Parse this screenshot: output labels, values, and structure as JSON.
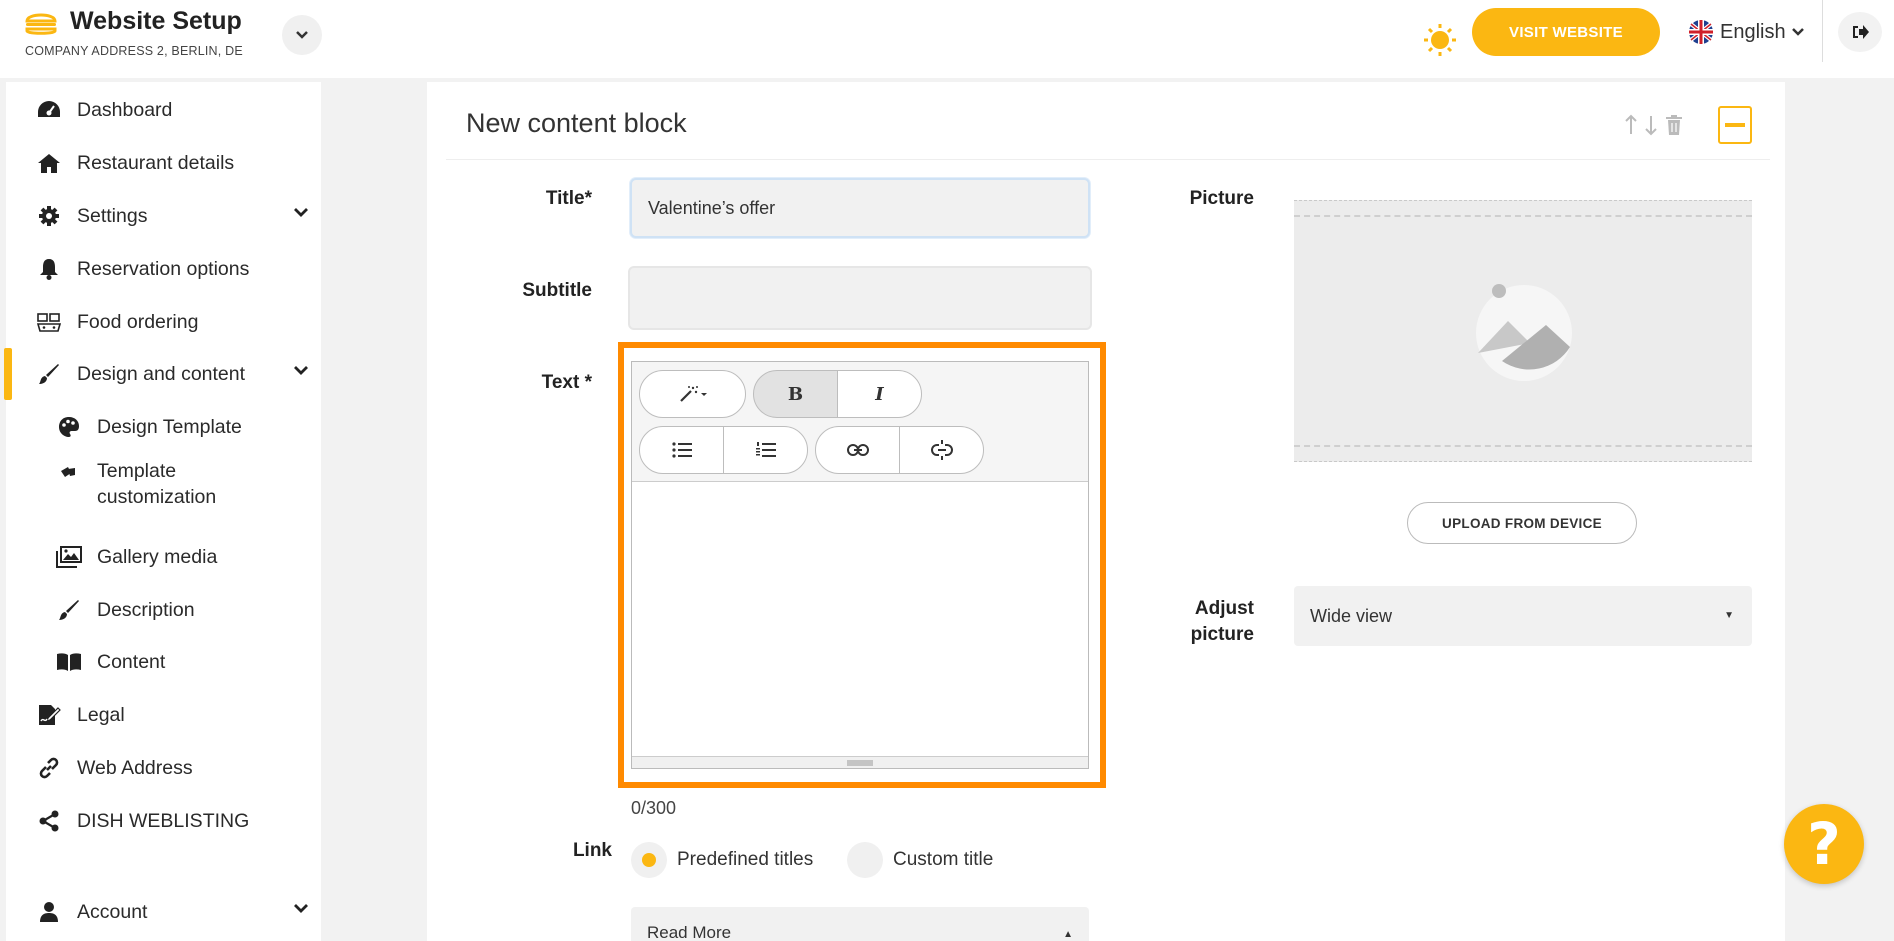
{
  "header": {
    "title": "Website Setup",
    "subtitle": "COMPANY ADDRESS 2, BERLIN, DE",
    "visit_label": "VISIT WEBSITE",
    "language": "English",
    "accent_color": "#fbb712"
  },
  "sidebar": {
    "items": [
      {
        "label": "Dashboard",
        "icon": "dashboard-icon"
      },
      {
        "label": "Restaurant details",
        "icon": "home-icon"
      },
      {
        "label": "Settings",
        "icon": "gear-icon"
      },
      {
        "label": "Reservation options",
        "icon": "bell-icon"
      },
      {
        "label": "Food ordering",
        "icon": "food-ordering-icon"
      },
      {
        "label": "Design and content",
        "icon": "paintbrush-icon"
      },
      {
        "label": "Design Template",
        "icon": "palette-icon"
      },
      {
        "label": "Template customization",
        "icon": "swatches-icon"
      },
      {
        "label": "Gallery media",
        "icon": "image-icon"
      },
      {
        "label": "Description",
        "icon": "paintbrush-icon"
      },
      {
        "label": "Content",
        "icon": "book-icon"
      },
      {
        "label": "Legal",
        "icon": "signature-icon"
      },
      {
        "label": "Web Address",
        "icon": "link-icon"
      },
      {
        "label": "DISH WEBLISTING",
        "icon": "share-icon"
      },
      {
        "label": "Account",
        "icon": "user-icon"
      }
    ],
    "template_customization_line1": "Template",
    "template_customization_line2": "customization"
  },
  "block": {
    "title": "New content block",
    "title_label": "Title*",
    "title_value": "Valentine’s offer",
    "subtitle_label": "Subtitle",
    "subtitle_value": "",
    "text_label": "Text *",
    "counter": "0/300",
    "link_label": "Link",
    "link_option_predefined": "Predefined titles",
    "link_option_custom": "Custom title",
    "link_selected": "Read More",
    "picture_label": "Picture",
    "upload_label": "UPLOAD FROM DEVICE",
    "adjust_label_line1": "Adjust",
    "adjust_label_line2": "picture",
    "adjust_value": "Wide view"
  },
  "help": {
    "label": "?"
  }
}
